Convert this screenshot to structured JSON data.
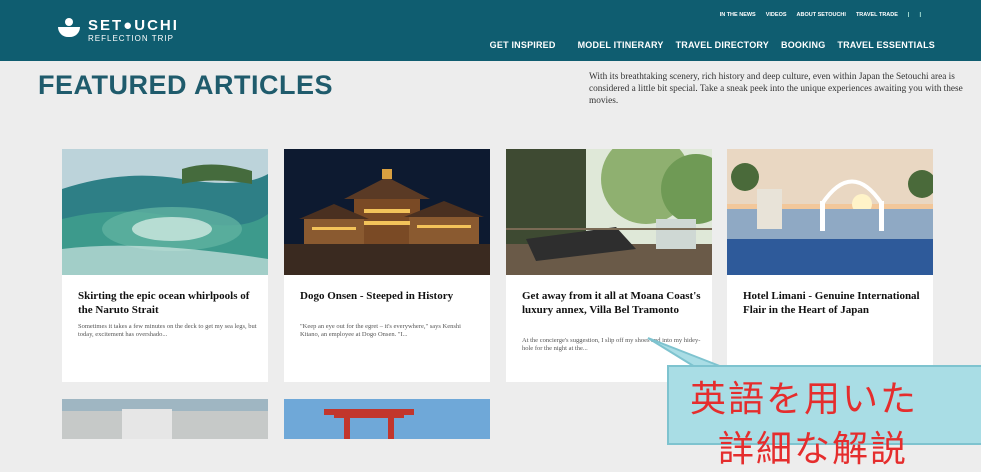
{
  "header": {
    "logo_title": "SET●UCHI",
    "logo_sub": "REFLECTION TRIP",
    "top_links": [
      "IN THE NEWS",
      "VIDEOS",
      "ABOUT SETOUCHI",
      "TRAVEL TRADE"
    ],
    "main_links": [
      "GET INSPIRED",
      "MODEL ITINERARY",
      "TRAVEL DIRECTORY",
      "BOOKING",
      "TRAVEL ESSENTIALS"
    ]
  },
  "page": {
    "title": "FEATURED ARTICLES",
    "intro": "With its breathtaking scenery, rich history and deep culture, even within Japan the Setouchi area is considered a little bit special. Take a sneak peek into the unique experiences awaiting you with these movies."
  },
  "articles": [
    {
      "title": "Skirting the epic ocean whirlpools of the Naruto Strait",
      "excerpt": "Sometimes it takes a few minutes on the deck to get my sea legs, but today, excitement has overshado..."
    },
    {
      "title": "Dogo Onsen - Steeped in History",
      "excerpt": "\"Keep an eye out for the egret – it's everywhere,\" says Kenshi Kitano, an employee at Dogo Onsen. \"I..."
    },
    {
      "title": "Get away from it all at Moana Coast's luxury annex, Villa Bel Tramonto",
      "excerpt": "At the concierge's suggestion, I slip off my shoes and into my hidey-hole for the night at the..."
    },
    {
      "title": "Hotel Limani - Genuine International Flair in the Heart of Japan",
      "excerpt": ""
    }
  ],
  "annotation": {
    "line1": "英語を用いた",
    "line2": "詳細な解説"
  },
  "colors": {
    "header_bg": "#0f5d70",
    "heading": "#1f5b6c",
    "annotation_bg": "#a9dde5",
    "annotation_text": "#e52d2d"
  }
}
